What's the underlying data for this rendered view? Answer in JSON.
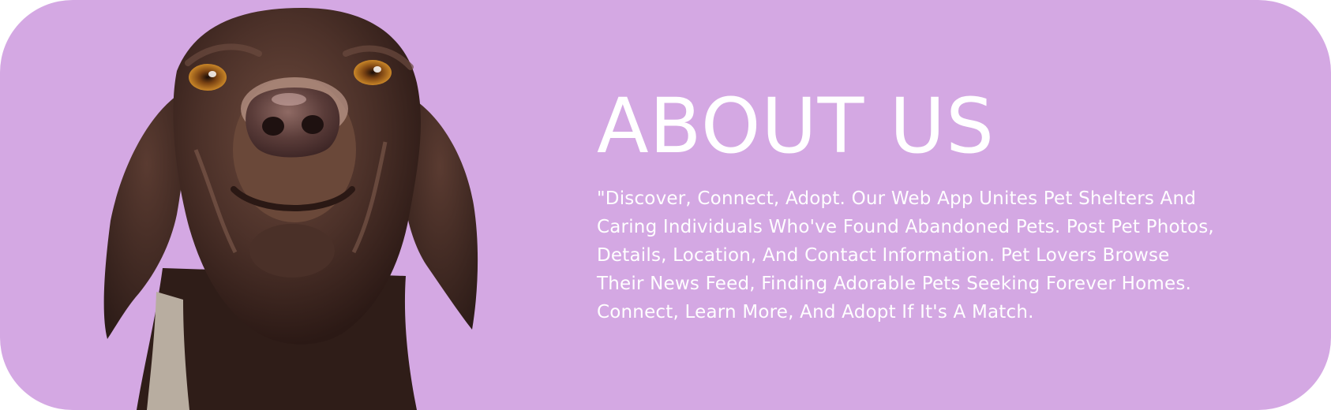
{
  "about": {
    "title": "ABOUT US",
    "description": "\"Discover, Connect, Adopt. Our Web App Unites Pet Shelters And Caring Individuals Who've Found Abandoned Pets. Post Pet Photos, Details, Location, And Contact Information. Pet Lovers Browse Their News Feed, Finding Adorable Pets Seeking Forever Homes. Connect, Learn More, And Adopt If It's A Match."
  },
  "colors": {
    "card_background": "#d4a8e3",
    "text": "#ffffff",
    "dog_fur": "#4a3129"
  },
  "image": {
    "icon": "dog-photo"
  }
}
